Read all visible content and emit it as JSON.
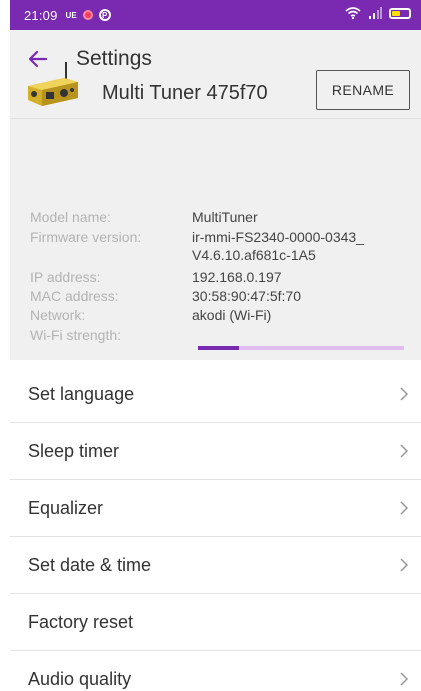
{
  "status_bar": {
    "time": "21:09",
    "carrier": "UE",
    "p_letter": "P"
  },
  "header": {
    "title": "Settings",
    "back_icon": "arrow-left-icon"
  },
  "device": {
    "name": "Multi Tuner 475f70",
    "rename_label": "RENAME"
  },
  "info": {
    "model_label": "Model name:",
    "model_value": "MultiTuner",
    "firmware_label": "Firmware version:",
    "firmware_value_line1": "ir-mmi-FS2340-0000-0343_",
    "firmware_value_line2": "V4.6.10.af681c-1A5",
    "ip_label": "IP address:",
    "ip_value": "192.168.0.197",
    "mac_label": "MAC address:",
    "mac_value": "30:58:90:47:5f:70",
    "network_label": "Network:",
    "network_value": "akodi (Wi-Fi)",
    "wifi_label": "Wi-Fi strength:",
    "wifi_strength_fraction": 0.2
  },
  "menu": {
    "items": [
      {
        "label": "Set language",
        "chevron": true
      },
      {
        "label": "Sleep timer",
        "chevron": true
      },
      {
        "label": "Equalizer",
        "chevron": true
      },
      {
        "label": "Set date & time",
        "chevron": true
      },
      {
        "label": "Factory reset",
        "chevron": false
      },
      {
        "label": "Audio quality",
        "chevron": true
      }
    ]
  },
  "colors": {
    "accent": "#7a2ab0",
    "wifi_track": "#e0bdf0",
    "label_gray": "#b3b3b3"
  }
}
